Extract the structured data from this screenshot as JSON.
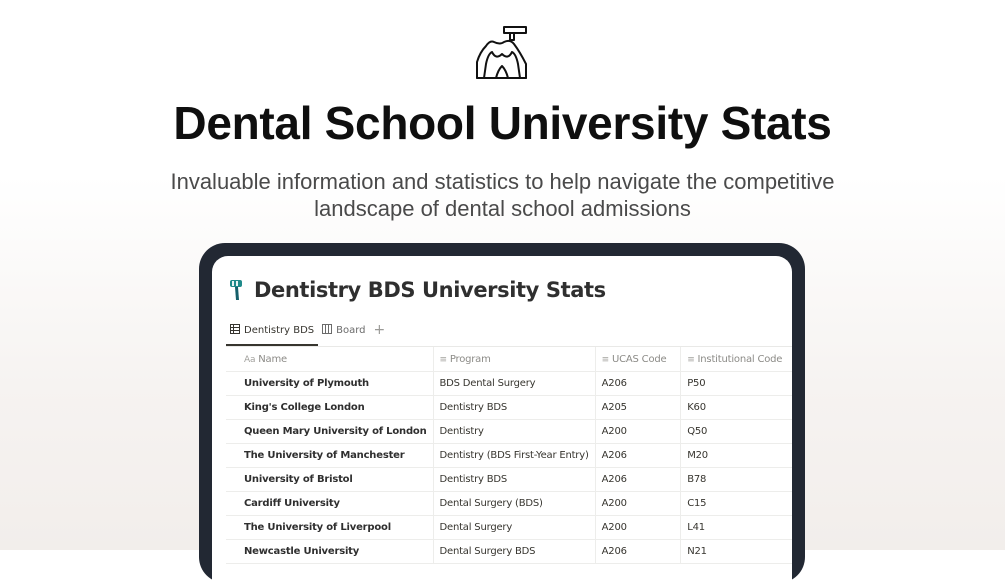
{
  "hero": {
    "title": "Dental School University Stats",
    "subtitle": "Invaluable information and statistics to help navigate the competitive landscape of dental school admissions",
    "icon": "dental-tooth-drill-icon"
  },
  "page": {
    "title": "Dentistry BDS University Stats",
    "icon": "toothbrush-icon"
  },
  "views": {
    "tabs": [
      {
        "label": "Dentistry BDS",
        "icon": "table-icon"
      },
      {
        "label": "Board",
        "icon": "board-icon"
      }
    ],
    "add_label": "+"
  },
  "table": {
    "columns": [
      {
        "icon": "Aa",
        "label": "Name"
      },
      {
        "icon": "≡",
        "label": "Program"
      },
      {
        "icon": "≡",
        "label": "UCAS Code"
      },
      {
        "icon": "≡",
        "label": "Institutional Code"
      }
    ],
    "rows": [
      {
        "name": "University of Plymouth",
        "program": "BDS Dental Surgery",
        "ucas": "A206",
        "inst": "P50"
      },
      {
        "name": "King's College London",
        "program": "Dentistry BDS",
        "ucas": "A205",
        "inst": "K60"
      },
      {
        "name": "Queen Mary University of London",
        "program": "Dentistry",
        "ucas": "A200",
        "inst": "Q50"
      },
      {
        "name": "The University of Manchester",
        "program": "Dentistry (BDS First-Year Entry)",
        "ucas": "A206",
        "inst": "M20"
      },
      {
        "name": "University of Bristol",
        "program": "Dentistry BDS",
        "ucas": "A206",
        "inst": "B78"
      },
      {
        "name": "Cardiff University",
        "program": "Dental Surgery (BDS)",
        "ucas": "A200",
        "inst": "C15"
      },
      {
        "name": "The University of Liverpool",
        "program": "Dental Surgery",
        "ucas": "A200",
        "inst": "L41"
      },
      {
        "name": "Newcastle University",
        "program": "Dental Surgery BDS",
        "ucas": "A206",
        "inst": "N21"
      }
    ]
  },
  "colors": {
    "device_frame": "#222833",
    "title_text": "#0f0f0f",
    "subtitle_text": "#4a4a4a",
    "icon_teal": "#1f8a8a"
  }
}
